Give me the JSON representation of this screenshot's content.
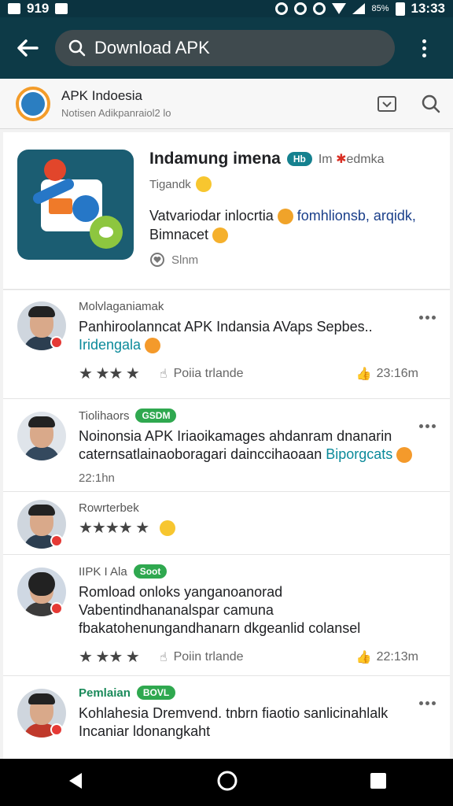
{
  "status_bar": {
    "left_text": "919",
    "battery": "85%",
    "time": "13:33"
  },
  "search": {
    "query": "Download APK"
  },
  "site": {
    "name": "APK Indoesia",
    "subtitle": "Notisen Adikpanraiol2",
    "subtitle_suffix": "lo"
  },
  "app": {
    "title": "Indamung imena",
    "badge": "Hb",
    "developer": "Im",
    "developer_suffix": "edmka",
    "sub": "Tigandk",
    "description_1": "Vatvariodar inlocrtia",
    "description_2": "fomhlionsb, arqidk,",
    "description_3": "Bimnacet",
    "meta": "Slnm"
  },
  "comments": [
    {
      "user": "Molvlaganiamak",
      "tag": "",
      "text": "Panhiroolanncat APK Indansia AVaps Sepbes..",
      "link": "Iridengala",
      "rating_stars": 4,
      "reply_label": "Poiia trlande",
      "likes": "23:16m",
      "time": ""
    },
    {
      "user": "Tiolihaors",
      "tag": "GSDM",
      "text": "Noinonsia APK Iriaoikamages ahdanram dnanarin caternsatlainaoboragari dainccihaoaan",
      "link": "Biporgcats",
      "rating_stars": 0,
      "reply_label": "",
      "likes": "",
      "time": "22:1hn"
    },
    {
      "user": "Rowrterbek",
      "tag": "",
      "text": "",
      "link": "",
      "rating_stars": 5,
      "reply_label": "",
      "likes": "",
      "time": ""
    },
    {
      "user": "IIPK I Ala",
      "tag": "Soot",
      "text": "Romload onloks yanganoanorad Vabentindhananalspar camuna fbakatohenungandhanarn dkgeanlid colansel",
      "link": "",
      "rating_stars": 4,
      "reply_label": "Poiin trlande",
      "likes": "22:13m",
      "time": ""
    },
    {
      "user": "Pemlaian",
      "tag": "BOVL",
      "text": "Kohlahesia Dremvend. tnbrn fiaotio sanlicinahlalk Incaniar ldonangkaht",
      "link": "",
      "rating_stars": 0,
      "reply_label": "",
      "likes": "",
      "time": ""
    }
  ],
  "icons": {
    "back": "arrow-left-icon",
    "search": "search-icon",
    "overflow": "more-vert-icon",
    "download": "download-box-icon",
    "nav_back": "triangle-back-icon",
    "nav_home": "circle-home-icon",
    "nav_recents": "square-recents-icon"
  },
  "colors": {
    "header": "#0d3a47",
    "accent": "#15818f",
    "tag_green": "#2fa84f"
  }
}
